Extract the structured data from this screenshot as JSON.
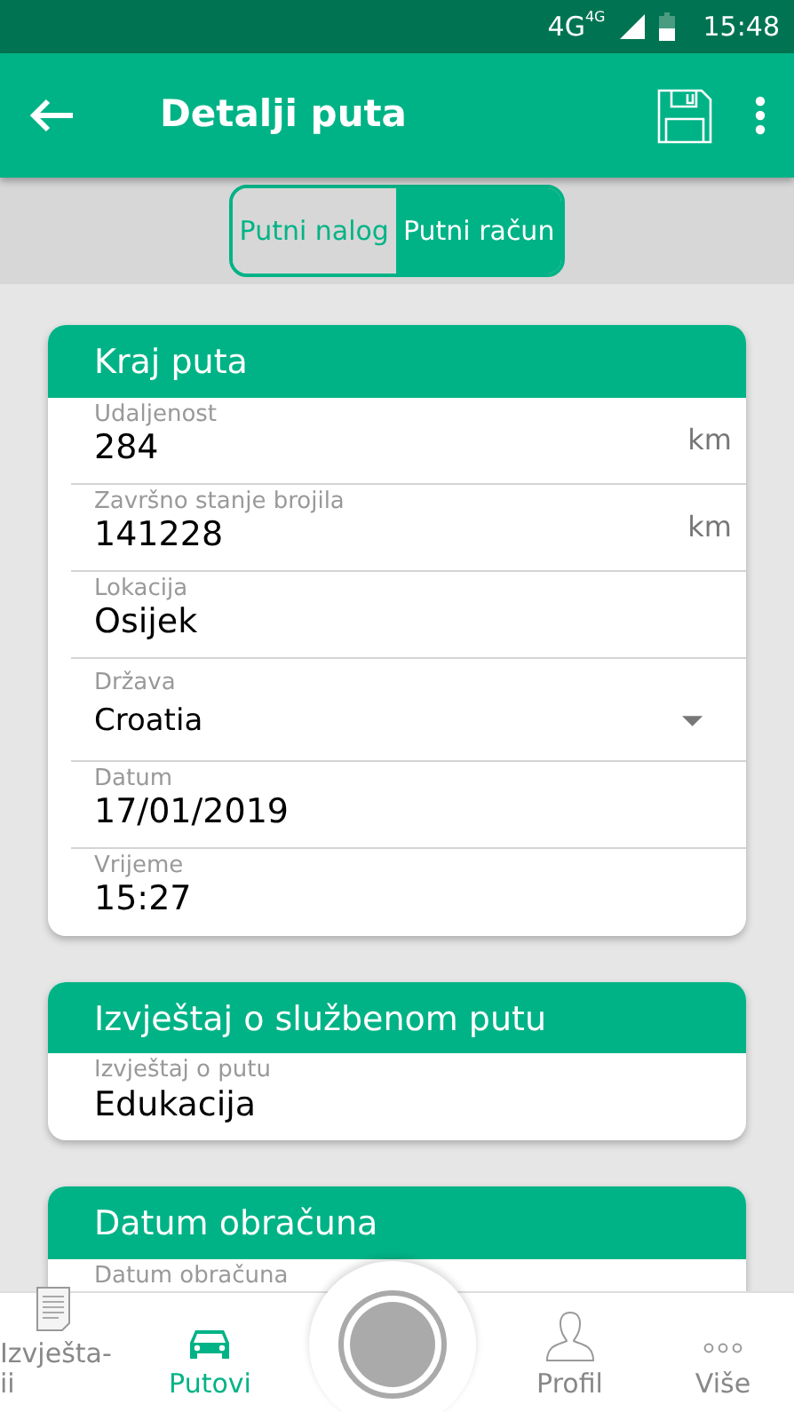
{
  "status_bar": {
    "network": "4G",
    "network_small": "4G",
    "time": "15:48"
  },
  "app_bar": {
    "title": "Detalji puta"
  },
  "segments": [
    {
      "label": "Putni nalog",
      "selected": false
    },
    {
      "label": "Putni račun",
      "selected": true
    }
  ],
  "sections": [
    {
      "title": "Kraj puta",
      "fields": [
        {
          "kind": "text",
          "label": "Udaljenost",
          "value": "284",
          "unit": "km"
        },
        {
          "kind": "text",
          "label": "Završno stanje brojila",
          "value": "141228",
          "unit": "km"
        },
        {
          "kind": "text",
          "label": "Lokacija",
          "value": "Osijek"
        },
        {
          "kind": "select",
          "label": "Država",
          "value": "Croatia"
        },
        {
          "kind": "text",
          "label": "Datum",
          "value": "17/01/2019"
        },
        {
          "kind": "text",
          "label": "Vrijeme",
          "value": "15:27"
        }
      ]
    },
    {
      "title": "Izvještaj o službenom putu",
      "fields": [
        {
          "kind": "text",
          "label": "Izvještaj o putu",
          "value": "Edukacija"
        }
      ]
    },
    {
      "title": "Datum obračuna",
      "fields": [
        {
          "kind": "text",
          "label": "Datum obračuna"
        }
      ]
    }
  ],
  "bottom_nav": [
    {
      "kind": "report",
      "label": "Izvješta-\nii",
      "selected": false
    },
    {
      "kind": "car",
      "label": "Putovi",
      "selected": true
    },
    {
      "kind": "record"
    },
    {
      "kind": "person",
      "label": "Profil",
      "selected": false
    },
    {
      "kind": "more",
      "label": "Više",
      "selected": false
    }
  ]
}
